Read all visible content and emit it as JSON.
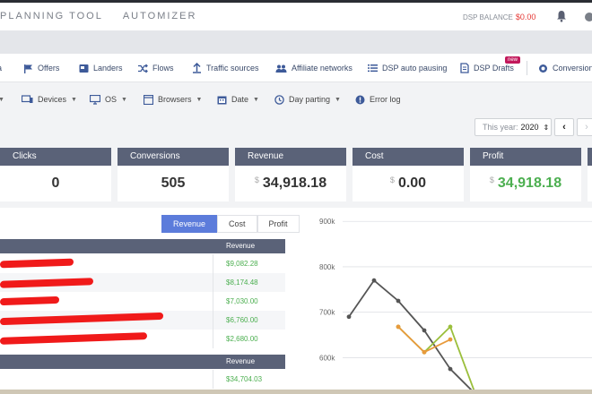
{
  "topbar": {
    "brand_1": "PLANNING TOOL",
    "brand_2": "AUTOMIZER",
    "dsp_label": "DSP BALANCE",
    "dsp_value": "$0.00"
  },
  "nav": {
    "items": [
      {
        "label": "a",
        "icon": "campaign-icon"
      },
      {
        "label": "Offers",
        "icon": "flag-icon"
      },
      {
        "label": "Landers",
        "icon": "lander-icon"
      },
      {
        "label": "Flows",
        "icon": "shuffle-icon"
      },
      {
        "label": "Traffic sources",
        "icon": "upload-icon"
      },
      {
        "label": "Affiliate networks",
        "icon": "users-icon"
      },
      {
        "label": "DSP auto pausing",
        "icon": "list-icon"
      },
      {
        "label": "DSP Drafts",
        "icon": "draft-icon"
      },
      {
        "label": "Conversions",
        "icon": "conversions-icon"
      }
    ],
    "new_badge": "new"
  },
  "filters": {
    "items": [
      {
        "label": "Devices",
        "icon": "devices-icon"
      },
      {
        "label": "OS",
        "icon": "monitor-icon"
      },
      {
        "label": "Browsers",
        "icon": "browser-icon"
      },
      {
        "label": "Date",
        "icon": "calendar-icon"
      },
      {
        "label": "Day parting",
        "icon": "clock-icon"
      },
      {
        "label": "Error log",
        "icon": "alert-icon"
      }
    ]
  },
  "period": {
    "label": "This year:",
    "value": "2020"
  },
  "kpis": [
    {
      "label": "Clicks",
      "value": "0"
    },
    {
      "label": "Conversions",
      "value": "505"
    },
    {
      "label": "Revenue",
      "currency": "$",
      "value": "34,918.18"
    },
    {
      "label": "Cost",
      "currency": "$",
      "value": "0.00"
    },
    {
      "label": "Profit",
      "currency": "$",
      "value": "34,918.18"
    }
  ],
  "tabs": [
    "Revenue",
    "Cost",
    "Profit"
  ],
  "table1": {
    "header": "Revenue",
    "rows": [
      "$9,082.28",
      "$8,174.48",
      "$7,030.00",
      "$6,760.00",
      "$2,680.00"
    ]
  },
  "table2": {
    "header": "Revenue",
    "rows": [
      "$34,704.03"
    ]
  },
  "chart_data": {
    "type": "line",
    "y_ticks": [
      "900k",
      "800k",
      "700k",
      "600k"
    ],
    "ylim": [
      520000,
      930000
    ],
    "grid": true,
    "series": [
      {
        "color": "#555555",
        "values": [
          690000,
          770000,
          725000,
          660000,
          575000,
          520000
        ]
      },
      {
        "color": "#9bbf3c",
        "values": [
          null,
          null,
          668000,
          612000,
          668000,
          520000
        ]
      },
      {
        "color": "#e89a3c",
        "values": [
          null,
          null,
          668000,
          612000,
          640000,
          null
        ]
      }
    ],
    "colors": {
      "kpi_header": "#5a6278",
      "positive": "#4caf50",
      "accent": "#5c7cdb"
    }
  }
}
